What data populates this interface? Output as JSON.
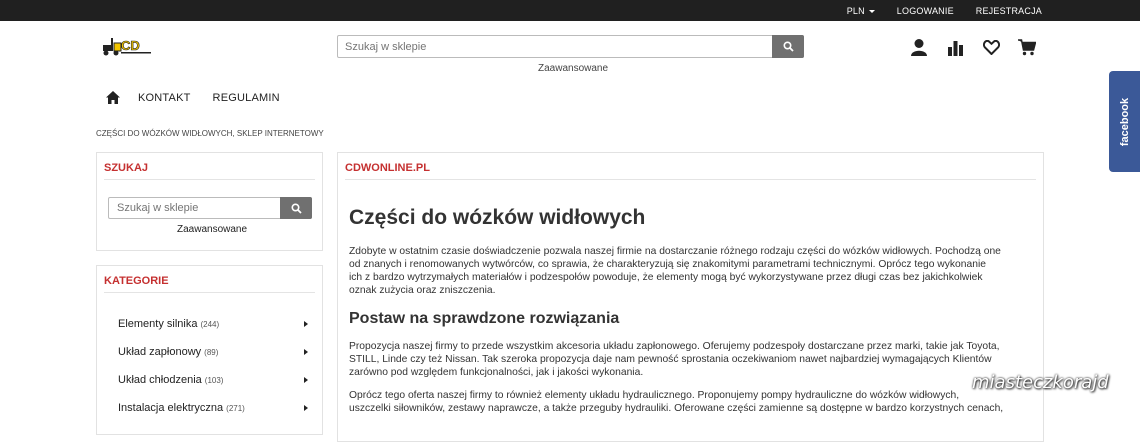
{
  "topbar": {
    "currency": "PLN",
    "login": "LOGOWANIE",
    "register": "REJESTRACJA"
  },
  "header": {
    "search_placeholder": "Szukaj w sklepie",
    "advanced": "Zaawansowane",
    "icons": [
      "user-icon",
      "bar-chart-icon",
      "heart-icon",
      "cart-icon"
    ]
  },
  "nav": {
    "items": [
      "KONTAKT",
      "REGULAMIN"
    ]
  },
  "breadcrumb": "CZĘŚCI DO WÓZKÓW WIDŁOWYCH, SKLEP INTERNETOWY",
  "sidebar": {
    "search": {
      "title": "SZUKAJ",
      "placeholder": "Szukaj w sklepie",
      "advanced": "Zaawansowane"
    },
    "categories": {
      "title": "KATEGORIE",
      "items": [
        {
          "label": "Elementy silnika",
          "count": "(244)"
        },
        {
          "label": "Układ zapłonowy",
          "count": "(89)"
        },
        {
          "label": "Układ chłodzenia",
          "count": "(103)"
        },
        {
          "label": "Instalacja elektryczna",
          "count": "(271)"
        }
      ]
    }
  },
  "content": {
    "header": "CDWONLINE.PL",
    "title": "Części do wózków widłowych",
    "p1_lines": [
      "Zdobyte w ostatnim czasie doświadczenie pozwala naszej firmie na dostarczanie różnego rodzaju części do wózków widłowych. Pochodzą one",
      "od znanych i renomowanych wytwórców, co sprawia, że charakteryzują się znakomitymi parametrami technicznymi. Oprócz tego wykonanie",
      "ich z bardzo wytrzymałych materiałów i podzespołów powoduje, że elementy mogą być wykorzystywane przez długi czas bez jakichkolwiek",
      "oznak zużycia oraz zniszczenia."
    ],
    "h2": "Postaw na sprawdzone rozwiązania",
    "p2_lines": [
      "Propozycja naszej firmy to przede wszystkim akcesoria układu zapłonowego. Oferujemy podzespoły dostarczane przez marki, takie jak Toyota,",
      "STILL, Linde czy też Nissan. Tak szeroka propozycja daje nam pewność sprostania oczekiwaniom nawet najbardziej wymagających Klientów",
      "zarówno pod względem funkcjonalności, jak i jakości wykonania."
    ],
    "p3_lines": [
      "Oprócz tego oferta naszej firmy to również elementy układu hydraulicznego. Proponujemy pompy hydrauliczne do wózków widłowych,",
      "uszczelki siłowników, zestawy naprawcze, a także przeguby hydrauliki. Oferowane części zamienne są dostępne w bardzo korzystnych cenach,"
    ]
  },
  "facebook": "facebook",
  "watermark": "miasteczkorajd"
}
